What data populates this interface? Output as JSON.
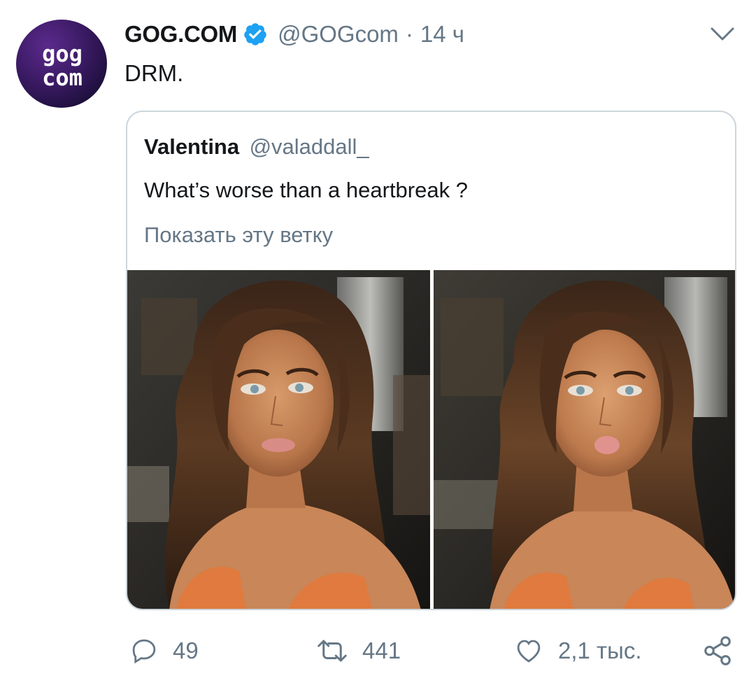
{
  "tweet": {
    "author_name": "GOG.COM",
    "handle": "@GOGcom",
    "separator": "·",
    "time": "14 ч",
    "text": "DRM.",
    "verified": true,
    "avatar_text": {
      "line1": "gog",
      "line2": "com"
    }
  },
  "quoted_tweet": {
    "author_name": "Valentina",
    "handle": "@valaddall_",
    "text": "What’s worse than a heartbreak ?",
    "show_thread": "Показать эту ветку",
    "photos": [
      "selfie-photo-1",
      "selfie-photo-2"
    ]
  },
  "actions": {
    "reply_count": "49",
    "retweet_count": "441",
    "like_count": "2,1 тыс."
  },
  "colors": {
    "text": "#14171a",
    "secondary": "#657786",
    "verified": "#1da1f2",
    "border": "#ccd6dd",
    "avatar_bg": "#3a1a63"
  },
  "icons": [
    "verified-icon",
    "chevron-down-icon",
    "reply-icon",
    "retweet-icon",
    "like-icon",
    "share-icon"
  ]
}
